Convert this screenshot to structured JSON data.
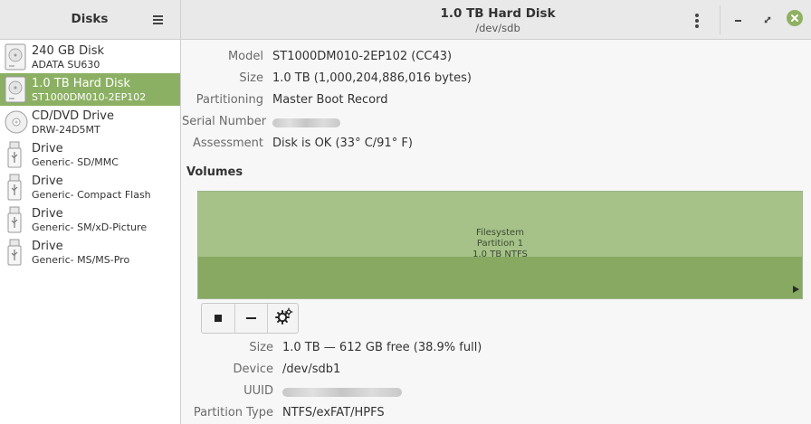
{
  "header": {
    "app_title": "Disks",
    "disk_title": "1.0 TB Hard Disk",
    "disk_subtitle": "/dev/sdb"
  },
  "sidebar": {
    "items": [
      {
        "label": "240 GB Disk",
        "sublabel": "ADATA SU630",
        "icon": "hard-disk-icon",
        "selected": false
      },
      {
        "label": "1.0 TB Hard Disk",
        "sublabel": "ST1000DM010-2EP102",
        "icon": "hard-disk-icon",
        "selected": true
      },
      {
        "label": "CD/DVD Drive",
        "sublabel": "DRW-24D5MT",
        "icon": "optical-disc-icon",
        "selected": false
      },
      {
        "label": "Drive",
        "sublabel": "Generic- SD/MMC",
        "icon": "usb-drive-icon",
        "selected": false
      },
      {
        "label": "Drive",
        "sublabel": "Generic- Compact Flash",
        "icon": "usb-drive-icon",
        "selected": false
      },
      {
        "label": "Drive",
        "sublabel": "Generic- SM/xD-Picture",
        "icon": "usb-drive-icon",
        "selected": false
      },
      {
        "label": "Drive",
        "sublabel": "Generic- MS/MS-Pro",
        "icon": "usb-drive-icon",
        "selected": false
      }
    ]
  },
  "disk": {
    "model_label": "Model",
    "model_value": "ST1000DM010-2EP102 (CC43)",
    "size_label": "Size",
    "size_value": "1.0 TB (1,000,204,886,016 bytes)",
    "partitioning_label": "Partitioning",
    "partitioning_value": "Master Boot Record",
    "serial_label": "Serial Number",
    "assessment_label": "Assessment",
    "assessment_value": "Disk is OK (33° C/91° F)"
  },
  "volumes": {
    "title": "Volumes",
    "partition": {
      "line1": "Filesystem",
      "line2": "Partition 1",
      "line3": "1.0 TB NTFS"
    },
    "toolbar": [
      "stop-icon",
      "minus-icon",
      "gear-icon"
    ]
  },
  "partition_details": {
    "size_label": "Size",
    "size_value": "1.0 TB — 612 GB free (38.9% full)",
    "device_label": "Device",
    "device_value": "/dev/sdb1",
    "uuid_label": "UUID",
    "type_label": "Partition Type",
    "type_value": "NTFS/exFAT/HPFS"
  },
  "colors": {
    "accent": "#8cb063",
    "volume_top": "#a6c288",
    "volume_bottom": "#87a962"
  }
}
